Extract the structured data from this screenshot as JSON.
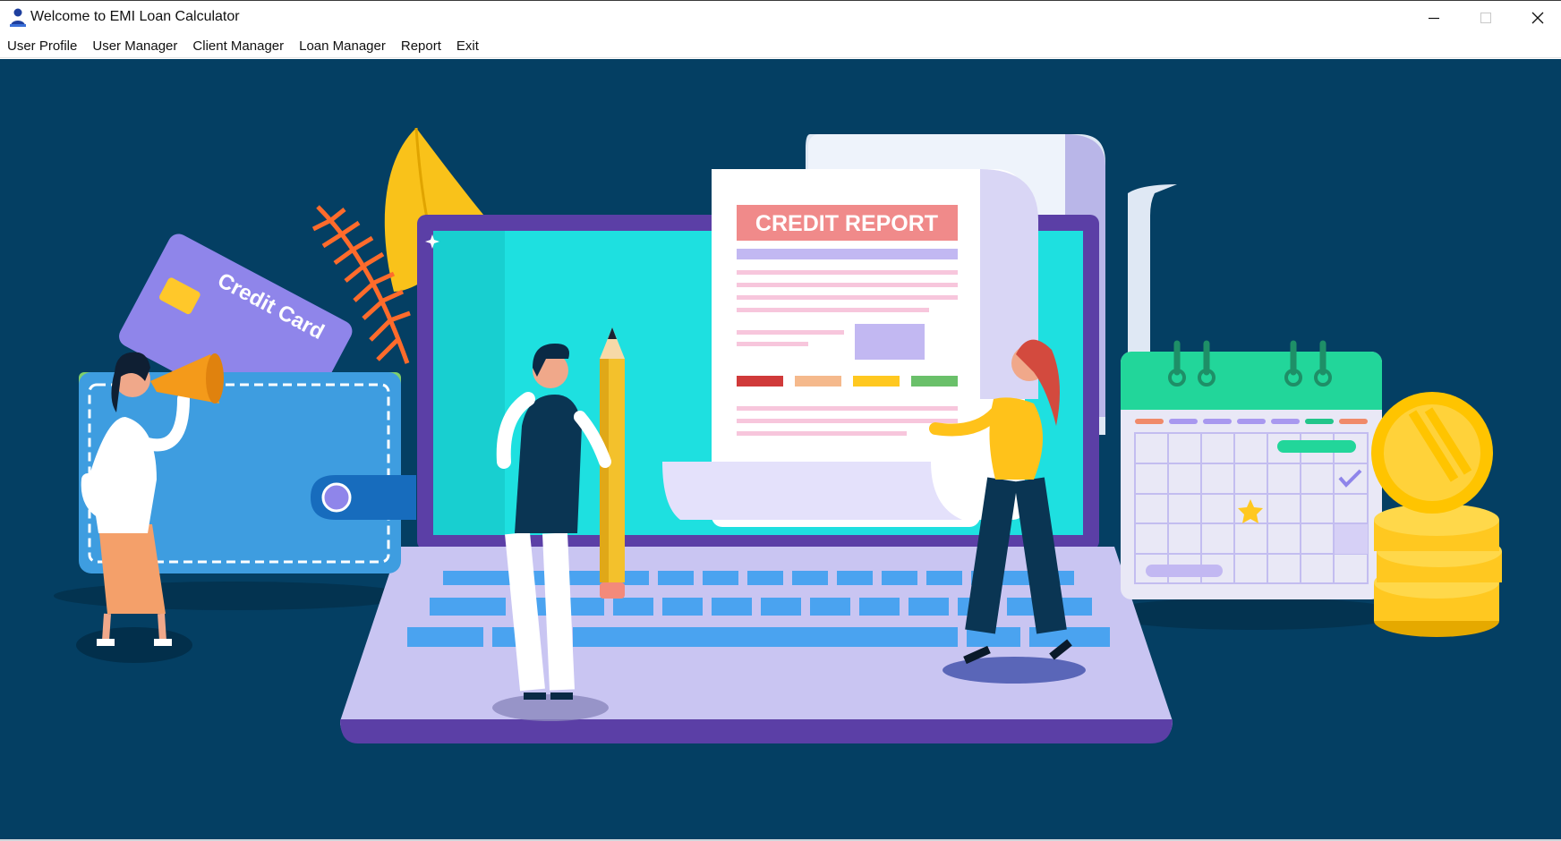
{
  "window": {
    "title": "Welcome to EMI Loan Calculator",
    "app_icon": "user-icon",
    "controls": {
      "minimize": "minimize-icon",
      "maximize": "maximize-icon",
      "close": "close-icon"
    }
  },
  "menu": [
    {
      "label": "User Profile"
    },
    {
      "label": "User Manager"
    },
    {
      "label": "Client Manager"
    },
    {
      "label": "Loan Manager"
    },
    {
      "label": "Report"
    },
    {
      "label": "Exit"
    }
  ],
  "illustration": {
    "report_heading": "CREDIT REPORT",
    "card_text": "Credit Card"
  },
  "colors": {
    "background": "#043f63",
    "screen": "#1ee0e0",
    "laptop_frame": "#5b3fa6",
    "report_header": "#f08a8a",
    "wallet": "#3e9de0",
    "coin": "#ffc400",
    "calendar_header": "#22d69a"
  }
}
